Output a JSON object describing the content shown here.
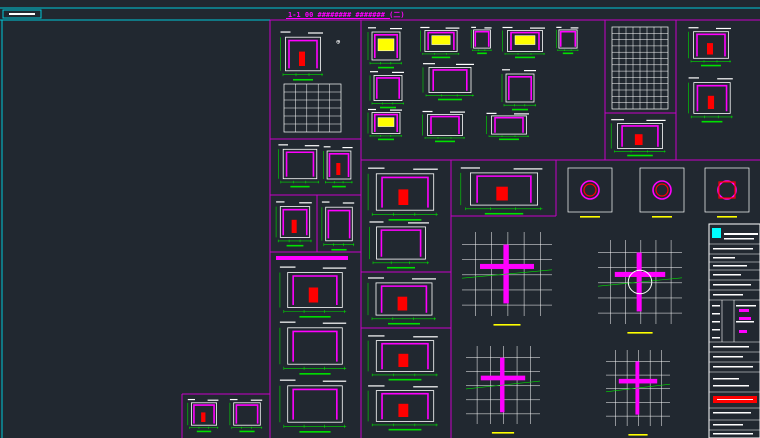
{
  "drawing": {
    "title": "1-1 00 ######## ####### (二)",
    "background": "#212830",
    "colors": {
      "frame": "#00c8d8",
      "sheet_border": "#c800c8",
      "detail_line": "#ffffff",
      "dimension": "#00e000",
      "rebar_main": "#ff00ff",
      "rebar_secondary": "#ff0000",
      "fill_yellow": "#ffff00",
      "label_bar": "#ffff00",
      "accent": "#00ffff"
    },
    "title_block": {
      "stamp_color": "#ff0000",
      "logo_color": "#00ffff"
    }
  }
}
